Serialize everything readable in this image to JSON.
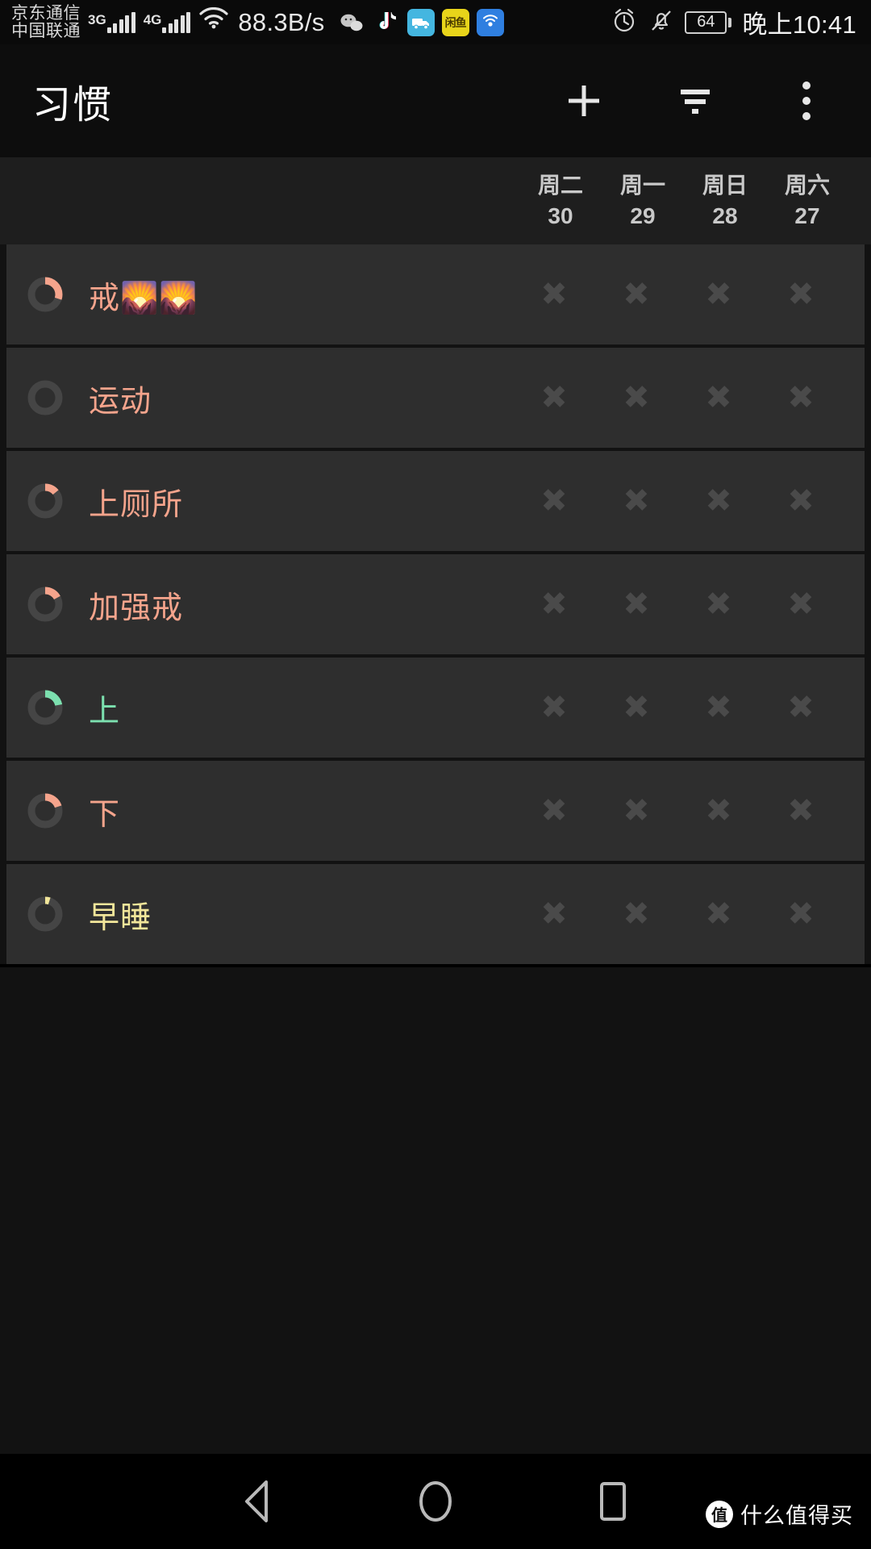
{
  "status_bar": {
    "carrier_line1": "京东通信",
    "carrier_line2": "中国联通",
    "network_tag_1": "3G",
    "network_tag_2": "4G",
    "wifi_icon": "wifi-icon",
    "net_speed": "88.3B/s",
    "app_icons": [
      {
        "name": "wechat-icon",
        "glyph": "💬",
        "color": "#bfbfbf"
      },
      {
        "name": "tiktok-icon",
        "glyph": "♪",
        "color": "#ff2d55"
      },
      {
        "name": "delivery-icon",
        "glyph": "🚚",
        "color": "#ffffff"
      },
      {
        "name": "xianyu-icon",
        "glyph": "闲鱼",
        "color": "#4a3b00"
      },
      {
        "name": "wireless-icon",
        "glyph": "((·))",
        "color": "#ffffff"
      }
    ],
    "alarm_icon": "alarm-clock-icon",
    "mute_icon": "bell-muted-icon",
    "battery_level": "64",
    "time": "晚上10:41"
  },
  "app_bar": {
    "title": "习惯",
    "add_label": "+",
    "filter_icon": "filter-icon",
    "overflow_icon": "more-vertical-icon"
  },
  "day_header": {
    "columns": [
      {
        "weekday": "周二",
        "date": "30"
      },
      {
        "weekday": "周一",
        "date": "29"
      },
      {
        "weekday": "周日",
        "date": "28"
      },
      {
        "weekday": "周六",
        "date": "27"
      }
    ]
  },
  "colors": {
    "accent_salmon": "#f5a48c",
    "accent_green": "#7ce0af",
    "accent_yellow": "#f2e69a",
    "ring_track": "#454545",
    "row_bg": "#2e2e2e",
    "x_mark": "#4a4a4a",
    "page_bg": "#121212"
  },
  "habits": [
    {
      "name": "戒🌄🌄",
      "label_text": "戒",
      "emoji": "🌄🌄",
      "color": "#f5a48c",
      "progress_percent": 30,
      "marks": [
        "✖",
        "✖",
        "✖",
        "✖"
      ]
    },
    {
      "name": "运动",
      "label_text": "运动",
      "emoji": "",
      "color": "#f5a48c",
      "progress_percent": 0,
      "marks": [
        "✖",
        "✖",
        "✖",
        "✖"
      ]
    },
    {
      "name": "上厕所",
      "label_text": "上厕所",
      "emoji": "",
      "color": "#f5a48c",
      "progress_percent": 14,
      "marks": [
        "✖",
        "✖",
        "✖",
        "✖"
      ]
    },
    {
      "name": "加强戒",
      "label_text": "加强戒",
      "emoji": "",
      "color": "#f5a48c",
      "progress_percent": 17,
      "marks": [
        "✖",
        "✖",
        "✖",
        "✖"
      ]
    },
    {
      "name": "上",
      "label_text": "上",
      "emoji": "",
      "color": "#7ce0af",
      "progress_percent": 22,
      "marks": [
        "✖",
        "✖",
        "✖",
        "✖"
      ]
    },
    {
      "name": "下",
      "label_text": "下",
      "emoji": "",
      "color": "#f5a48c",
      "progress_percent": 20,
      "marks": [
        "✖",
        "✖",
        "✖",
        "✖"
      ]
    },
    {
      "name": "早睡",
      "label_text": "早睡",
      "emoji": "",
      "color": "#f2e69a",
      "progress_percent": 5,
      "marks": [
        "✖",
        "✖",
        "✖",
        "✖"
      ]
    }
  ],
  "nav_bar": {
    "back_icon": "back-triangle-icon",
    "home_icon": "home-circle-icon",
    "recents_icon": "recents-square-icon"
  },
  "watermark": {
    "badge": "值",
    "text": "什么值得买"
  }
}
